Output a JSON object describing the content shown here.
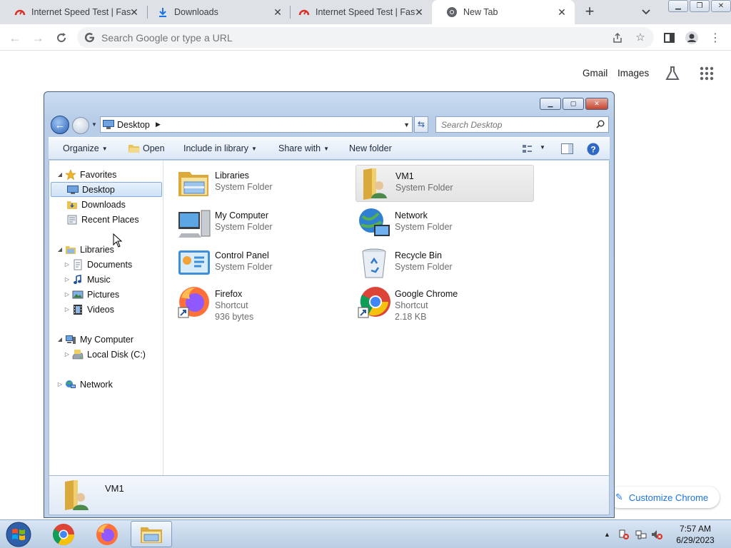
{
  "browser": {
    "tabs": [
      {
        "title": "Internet Speed Test | Fast.com",
        "icon": "speedometer-icon",
        "active": false
      },
      {
        "title": "Downloads",
        "icon": "download-icon",
        "active": false
      },
      {
        "title": "Internet Speed Test | Fast.com",
        "icon": "speedometer-icon",
        "active": false
      },
      {
        "title": "New Tab",
        "icon": "chrome-icon",
        "active": true
      }
    ],
    "new_tab_label": "+",
    "omnibox_placeholder": "Search Google or type a URL",
    "ntp": {
      "gmail": "Gmail",
      "images": "Images",
      "customize": "Customize Chrome"
    }
  },
  "explorer": {
    "address": {
      "crumb": "Desktop"
    },
    "search_placeholder": "Search Desktop",
    "commands": {
      "organize": "Organize",
      "open": "Open",
      "include": "Include in library",
      "share": "Share with",
      "new_folder": "New folder"
    },
    "nav": {
      "favorites": "Favorites",
      "desktop": "Desktop",
      "downloads": "Downloads",
      "recent": "Recent Places",
      "libraries": "Libraries",
      "documents": "Documents",
      "music": "Music",
      "pictures": "Pictures",
      "videos": "Videos",
      "computer": "My Computer",
      "local_disk": "Local Disk (C:)",
      "network": "Network"
    },
    "items": [
      {
        "name": "Libraries",
        "type": "System Folder",
        "icon": "libraries-icon"
      },
      {
        "name": "VM1",
        "type": "System Folder",
        "icon": "user-folder-icon",
        "selected": true
      },
      {
        "name": "My Computer",
        "type": "System Folder",
        "icon": "computer-icon"
      },
      {
        "name": "Network",
        "type": "System Folder",
        "icon": "network-icon"
      },
      {
        "name": "Control Panel",
        "type": "System Folder",
        "icon": "control-panel-icon"
      },
      {
        "name": "Recycle Bin",
        "type": "System Folder",
        "icon": "recycle-bin-icon"
      },
      {
        "name": "Firefox",
        "type": "Shortcut",
        "size": "936 bytes",
        "icon": "firefox-icon"
      },
      {
        "name": "Google Chrome",
        "type": "Shortcut",
        "size": "2.18 KB",
        "icon": "chrome-icon"
      }
    ],
    "details": {
      "name": "VM1"
    }
  },
  "taskbar": {
    "apps": [
      "chrome-icon",
      "firefox-icon",
      "explorer-icon"
    ],
    "clock": {
      "time": "7:57 AM",
      "date": "6/29/2023"
    }
  },
  "colors": {
    "accent": "#1a73e8",
    "tab_bg": "#dee1e6",
    "selection": "#cfe2f7"
  }
}
